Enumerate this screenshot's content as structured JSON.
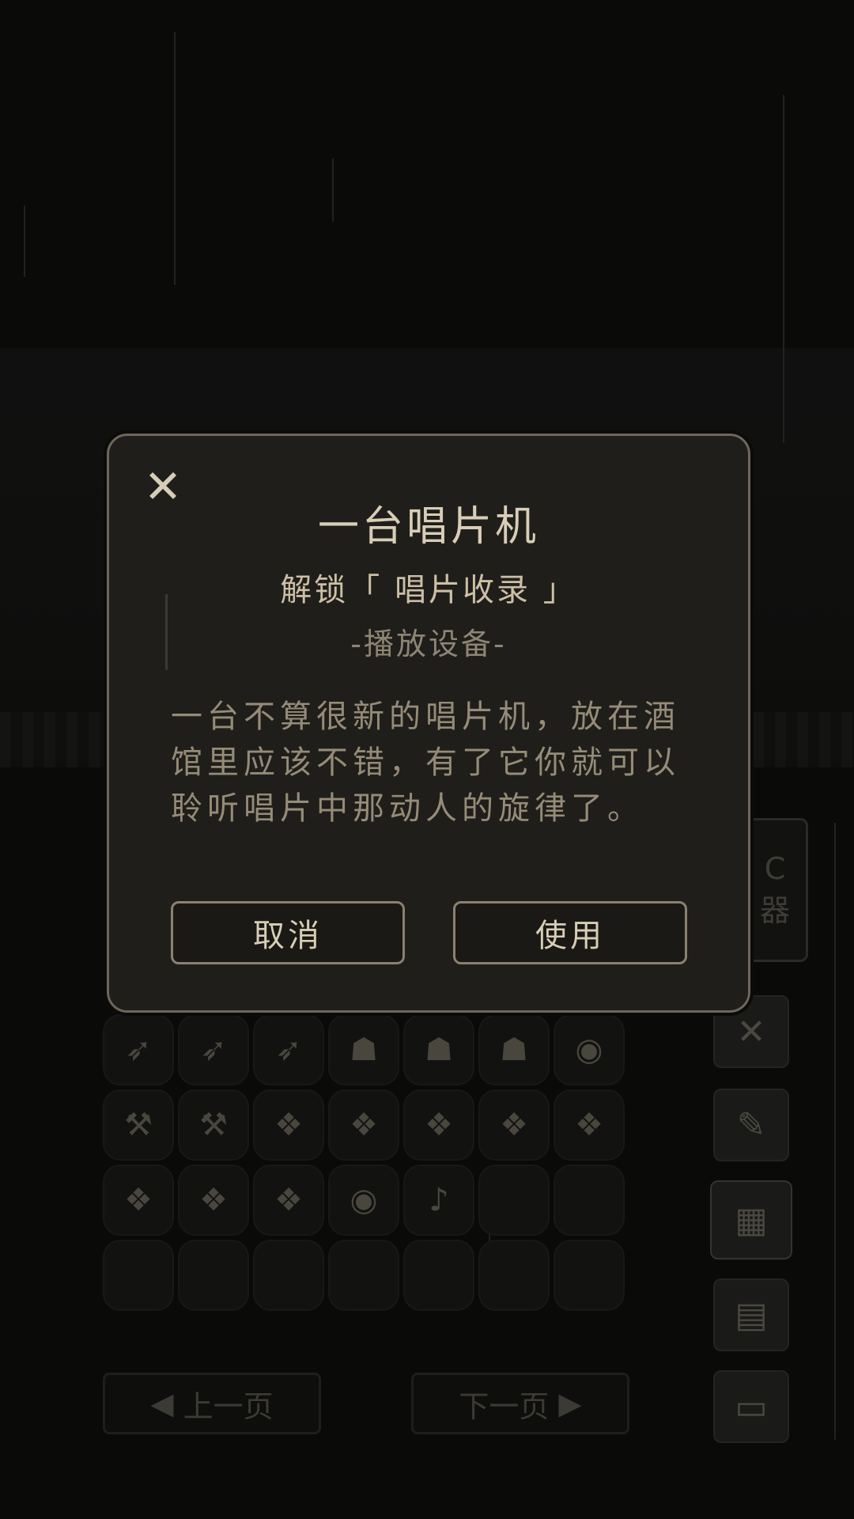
{
  "modal": {
    "title": "一台唱片机",
    "subtitle": "解锁「 唱片收录 」",
    "category": "-播放设备-",
    "description": "一台不算很新的唱片机，放在酒馆里应该不错，有了它你就可以聆听唱片中那动人的旋律了。",
    "cancel_label": "取消",
    "use_label": "使用",
    "close_icon": "✕"
  },
  "side_panel": {
    "label": "器"
  },
  "inventory": {
    "rows": [
      [
        "green-bow",
        "green-bow",
        "green-bow",
        "helmet",
        "helmet",
        "helmet",
        "shield"
      ],
      [
        "hammer",
        "hammer",
        "gem-cluster",
        "gem-cluster",
        "gem-cluster",
        "gem-cluster",
        "gem-cluster"
      ],
      [
        "gem-cluster",
        "gem-cluster",
        "gem-cluster",
        "shield",
        "gramophone",
        "empty",
        "empty"
      ],
      [
        "empty",
        "empty",
        "empty",
        "empty",
        "empty",
        "empty",
        "empty"
      ]
    ]
  },
  "pagination": {
    "prev_label": "上一页",
    "next_label": "下一页"
  },
  "colors": {
    "modal_bg": "#1f1e1a",
    "modal_border": "#6e665a",
    "text_primary": "#d8cdb6",
    "text_secondary": "#958b78"
  }
}
